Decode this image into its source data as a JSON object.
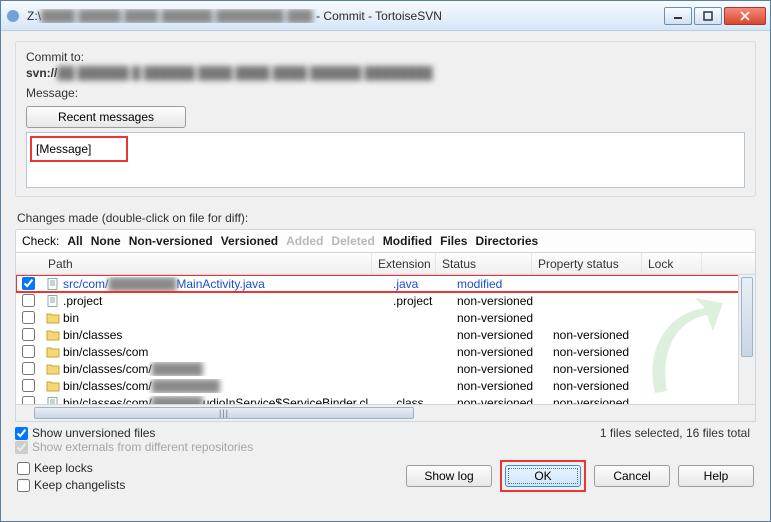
{
  "title_prefix": "Z:\\",
  "title_suffix": " - Commit - TortoiseSVN",
  "commit_to_label": "Commit to:",
  "svn_prefix": "svn://",
  "message_label": "Message:",
  "recent_messages_btn": "Recent messages",
  "message_text": "[Message]",
  "changes_label": "Changes made (double-click on file for diff):",
  "check_label": "Check:",
  "filters": {
    "all": "All",
    "none": "None",
    "nonversioned": "Non-versioned",
    "versioned": "Versioned",
    "added": "Added",
    "deleted": "Deleted",
    "modified": "Modified",
    "files": "Files",
    "directories": "Directories"
  },
  "columns": {
    "path": "Path",
    "extension": "Extension",
    "status": "Status",
    "pstatus": "Property status",
    "lock": "Lock"
  },
  "rows": [
    {
      "checked": true,
      "type": "file",
      "path_pre": "src/com/",
      "path_blur": "████████",
      "path_post": "MainActivity.java",
      "ext": ".java",
      "status": "modified",
      "pstatus": "",
      "selected": true
    },
    {
      "checked": false,
      "type": "file",
      "path_pre": ".project",
      "path_blur": "",
      "path_post": "",
      "ext": ".project",
      "status": "non-versioned",
      "pstatus": ""
    },
    {
      "checked": false,
      "type": "folder",
      "path_pre": "bin",
      "path_blur": "",
      "path_post": "",
      "ext": "",
      "status": "non-versioned",
      "pstatus": ""
    },
    {
      "checked": false,
      "type": "folder",
      "path_pre": "bin/classes",
      "path_blur": "",
      "path_post": "",
      "ext": "",
      "status": "non-versioned",
      "pstatus": "non-versioned"
    },
    {
      "checked": false,
      "type": "folder",
      "path_pre": "bin/classes/com",
      "path_blur": "",
      "path_post": "",
      "ext": "",
      "status": "non-versioned",
      "pstatus": "non-versioned"
    },
    {
      "checked": false,
      "type": "folder",
      "path_pre": "bin/classes/com/",
      "path_blur": "██████",
      "path_post": "",
      "ext": "",
      "status": "non-versioned",
      "pstatus": "non-versioned"
    },
    {
      "checked": false,
      "type": "folder",
      "path_pre": "bin/classes/com/",
      "path_blur": "████████",
      "path_post": "",
      "ext": "",
      "status": "non-versioned",
      "pstatus": "non-versioned"
    },
    {
      "checked": false,
      "type": "file",
      "path_pre": "bin/classes/com/",
      "path_blur": "██████",
      "path_post": "udioInService$ServiceBinder.cl...",
      "ext": ".class",
      "status": "non-versioned",
      "pstatus": "non-versioned"
    }
  ],
  "show_unversioned": "Show unversioned files",
  "show_externals": "Show externals from different repositories",
  "selection_status": "1 files selected, 16 files total",
  "keep_locks": "Keep locks",
  "keep_changelists": "Keep changelists",
  "buttons": {
    "showlog": "Show log",
    "ok": "OK",
    "cancel": "Cancel",
    "help": "Help"
  }
}
